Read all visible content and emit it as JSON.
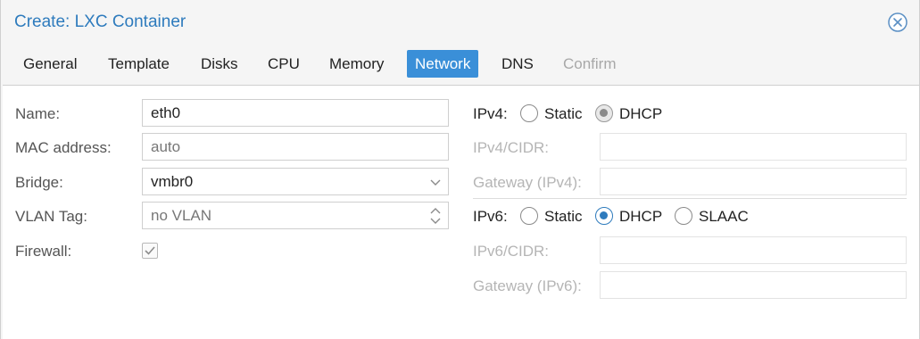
{
  "dialog": {
    "title": "Create: LXC Container",
    "close_icon": "close-circle-icon"
  },
  "tabs": [
    {
      "label": "General",
      "state": "normal"
    },
    {
      "label": "Template",
      "state": "normal"
    },
    {
      "label": "Disks",
      "state": "normal"
    },
    {
      "label": "CPU",
      "state": "normal"
    },
    {
      "label": "Memory",
      "state": "normal"
    },
    {
      "label": "Network",
      "state": "active"
    },
    {
      "label": "DNS",
      "state": "normal"
    },
    {
      "label": "Confirm",
      "state": "disabled"
    }
  ],
  "left": {
    "name": {
      "label": "Name:",
      "value": "eth0"
    },
    "mac": {
      "label": "MAC address:",
      "placeholder": "auto"
    },
    "bridge": {
      "label": "Bridge:",
      "value": "vmbr0"
    },
    "vlan": {
      "label": "VLAN Tag:",
      "placeholder": "no VLAN"
    },
    "firewall": {
      "label": "Firewall:",
      "checked": true
    }
  },
  "right": {
    "ipv4": {
      "label": "IPv4:",
      "options": [
        "Static",
        "DHCP"
      ],
      "selected": "DHCP",
      "cidr_label": "IPv4/CIDR:",
      "gateway_label": "Gateway (IPv4):"
    },
    "ipv6": {
      "label": "IPv6:",
      "options": [
        "Static",
        "DHCP",
        "SLAAC"
      ],
      "selected": "DHCP",
      "cidr_label": "IPv6/CIDR:",
      "gateway_label": "Gateway (IPv6):"
    }
  },
  "colors": {
    "accent": "#3a8fd8",
    "title": "#2e7bbd",
    "disabled_text": "#b5b5b5"
  }
}
